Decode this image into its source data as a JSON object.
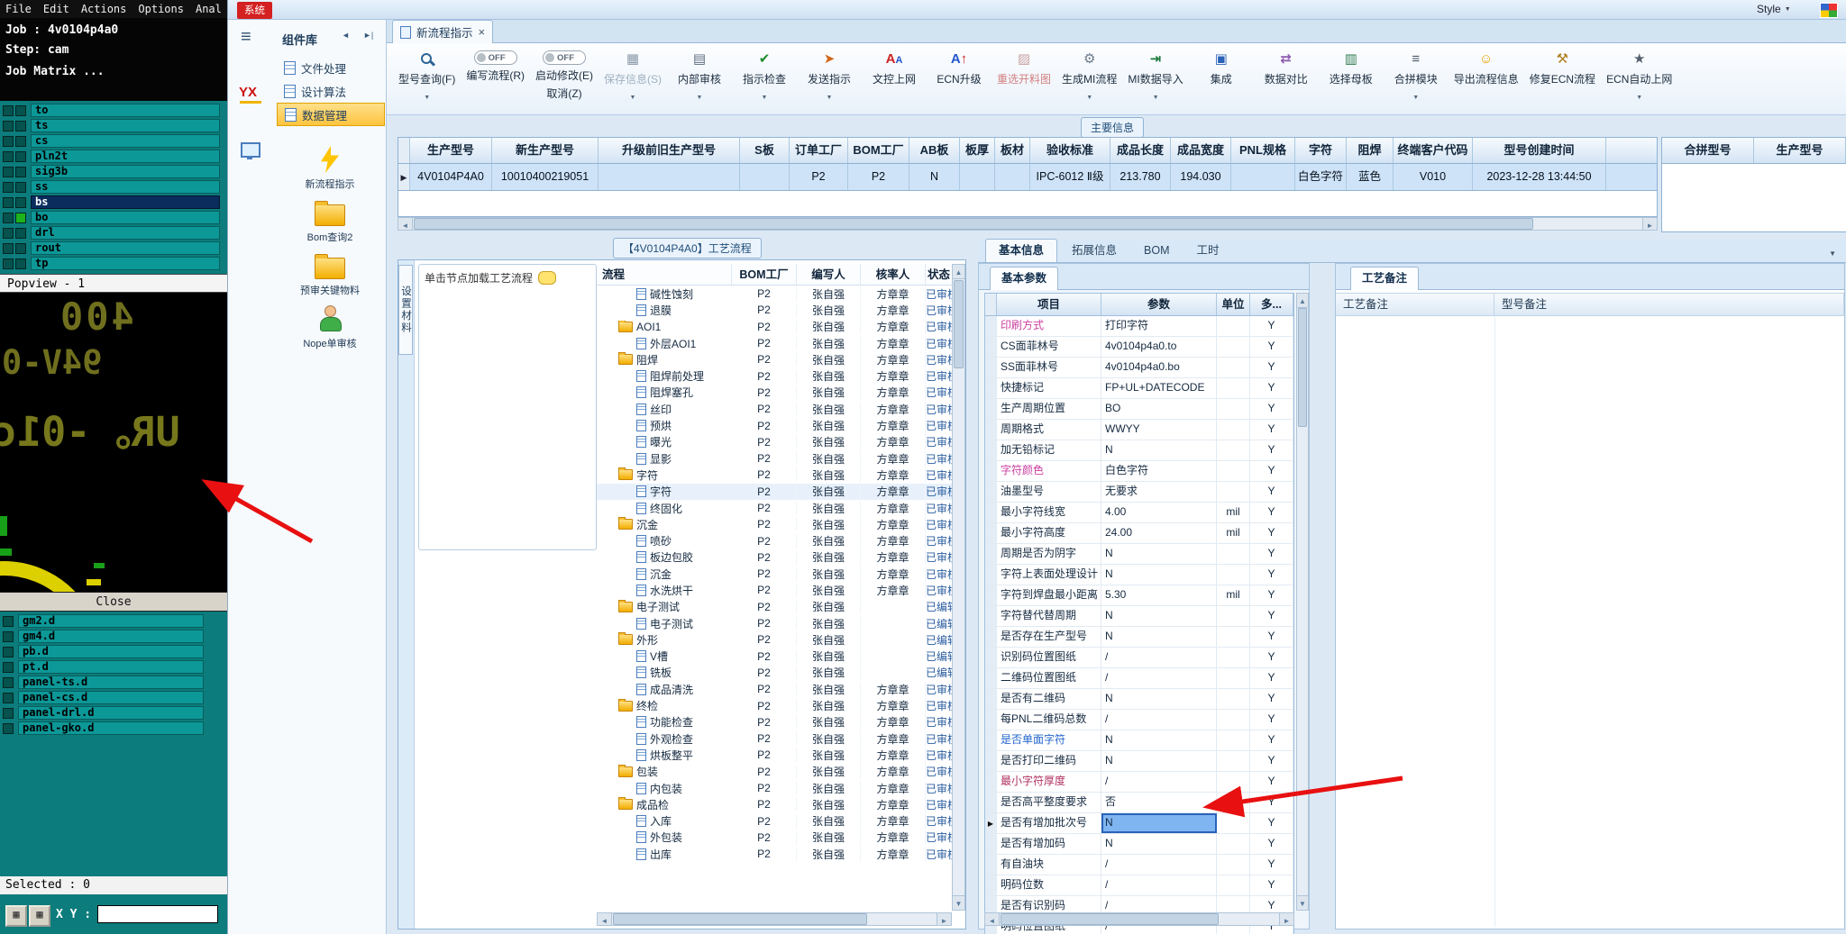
{
  "cam": {
    "menu": [
      "File",
      "Edit",
      "Actions",
      "Options",
      "Anal"
    ],
    "job_line": "Job : 4v0104p4a0",
    "step_line": "Step: cam",
    "matrix_button": "Job Matrix ...",
    "layers": [
      {
        "name": "to"
      },
      {
        "name": "ts"
      },
      {
        "name": "cs"
      },
      {
        "name": "pln2t"
      },
      {
        "name": "sig3b"
      },
      {
        "name": "ss"
      },
      {
        "name": "bs",
        "cls": "selected"
      },
      {
        "name": "bo",
        "cls": "marked"
      },
      {
        "name": "drl"
      },
      {
        "name": "rout"
      },
      {
        "name": "tp"
      }
    ],
    "popview_label": "Popview - 1",
    "viewport": {
      "text1": "400",
      "text2": "94V-0",
      "text3": "UR。-01c"
    },
    "close_label": "Close",
    "files": [
      {
        "name": "gm2.d"
      },
      {
        "name": "gm4.d"
      },
      {
        "name": "pb.d"
      },
      {
        "name": "pt.d"
      },
      {
        "name": "panel-ts.d"
      },
      {
        "name": "panel-cs.d"
      },
      {
        "name": "panel-drl.d"
      },
      {
        "name": "panel-gko.d"
      }
    ],
    "selected_label": "Selected : 0",
    "xy_label": "X Y :"
  },
  "system": {
    "window_tag": "系统",
    "style_label": "Style",
    "component_panel": {
      "title": "组件库",
      "logo": "YX",
      "sidebar": [
        {
          "label": "文件处理"
        },
        {
          "label": "设计算法"
        },
        {
          "label": "数据管理",
          "cls": "active"
        }
      ],
      "shortcuts": [
        {
          "label": "新流程指示",
          "icon": "lightning"
        },
        {
          "label": "Bom查询2",
          "icon": "folder"
        },
        {
          "label": "预审关键物料",
          "icon": "folder"
        },
        {
          "label": "Nope单审核",
          "icon": "person"
        }
      ]
    },
    "tab": {
      "label": "新流程指示"
    },
    "toolbar": [
      {
        "label": "型号查询(F)",
        "icon": "search",
        "dropdown": true
      },
      {
        "label": "编写流程(R)",
        "toggle": "OFF"
      },
      {
        "label": "启动修改(E)",
        "label2": "取消(Z)",
        "toggle": "OFF"
      },
      {
        "label": "保存信息(S)",
        "icon": "save",
        "cls": "disabled",
        "dropdown": true
      },
      {
        "label": "内部审核",
        "icon": "audit",
        "dropdown": true
      },
      {
        "label": "指示检查",
        "icon": "check",
        "dropdown": true
      },
      {
        "label": "发送指示",
        "icon": "send",
        "dropdown": true
      },
      {
        "label": "文控上网",
        "icon": "docnet"
      },
      {
        "label": "ECN升级",
        "icon": "ecnup"
      },
      {
        "label": "重选开料图",
        "icon": "repic",
        "cls": "red"
      },
      {
        "label": "生成MI流程",
        "icon": "gear",
        "dropdown": true
      },
      {
        "label": "MI数据导入",
        "icon": "import",
        "dropdown": true
      },
      {
        "label": "集成",
        "icon": "integrate"
      },
      {
        "label": "数据对比",
        "icon": "compare"
      },
      {
        "label": "选择母板",
        "icon": "board"
      },
      {
        "label": "合拼模块",
        "icon": "merge",
        "dropdown": true
      },
      {
        "label": "导出流程信息",
        "icon": "export"
      },
      {
        "label": "修复ECN流程",
        "icon": "fix"
      },
      {
        "label": "ECN自动上网",
        "icon": "star",
        "dropdown": true
      }
    ]
  },
  "main_info": {
    "tag": "主要信息",
    "columns": [
      "生产型号",
      "新生产型号",
      "升级前旧生产型号",
      "S板",
      "订单工厂",
      "BOM工厂",
      "AB板",
      "板厚",
      "板材",
      "验收标准",
      "成品长度",
      "成品宽度",
      "PNL规格",
      "字符",
      "阻焊",
      "终端客户代码",
      "型号创建时间"
    ],
    "row": [
      "4V0104P4A0",
      "10010400219051",
      "",
      "",
      "P2",
      "P2",
      "N",
      "",
      "",
      "IPC-6012 Ⅱ级",
      "213.780",
      "194.030",
      "",
      "白色字符",
      "蓝色",
      "V010",
      "2023-12-28 13:44:50"
    ],
    "extra_columns": [
      "合拼型号",
      "生产型号"
    ]
  },
  "process": {
    "tag": "【4V0104P4A0】工艺流程",
    "side_tab": "设置材料",
    "hint": "单击节点加载工艺流程",
    "columns": [
      "流程",
      "BOM工厂",
      "编写人",
      "核率人",
      "状态"
    ],
    "rows": [
      {
        "name": "碱性蚀刻",
        "icon": "doc",
        "cls": "lvl2",
        "factory": "P2",
        "writer": "张自强",
        "checker": "方章章",
        "status": "已审核"
      },
      {
        "name": "退膜",
        "icon": "doc",
        "cls": "lvl2",
        "factory": "P2",
        "writer": "张自强",
        "checker": "方章章",
        "status": "已审核"
      },
      {
        "name": "AOI1",
        "icon": "folder",
        "cls": "lvl1",
        "factory": "P2",
        "writer": "张自强",
        "checker": "方章章",
        "status": "已审核"
      },
      {
        "name": "外层AOI1",
        "icon": "doc",
        "cls": "lvl2",
        "factory": "P2",
        "writer": "张自强",
        "checker": "方章章",
        "status": "已审核"
      },
      {
        "name": "阻焊",
        "icon": "folder",
        "cls": "lvl1",
        "factory": "P2",
        "writer": "张自强",
        "checker": "方章章",
        "status": "已审核"
      },
      {
        "name": "阻焊前处理",
        "icon": "doc",
        "cls": "lvl2",
        "factory": "P2",
        "writer": "张自强",
        "checker": "方章章",
        "status": "已审核"
      },
      {
        "name": "阻焊塞孔",
        "icon": "doc",
        "cls": "lvl2",
        "factory": "P2",
        "writer": "张自强",
        "checker": "方章章",
        "status": "已审核"
      },
      {
        "name": "丝印",
        "icon": "doc",
        "cls": "lvl2",
        "factory": "P2",
        "writer": "张自强",
        "checker": "方章章",
        "status": "已审核"
      },
      {
        "name": "预烘",
        "icon": "doc",
        "cls": "lvl2",
        "factory": "P2",
        "writer": "张自强",
        "checker": "方章章",
        "status": "已审核"
      },
      {
        "name": "曝光",
        "icon": "doc",
        "cls": "lvl2",
        "factory": "P2",
        "writer": "张自强",
        "checker": "方章章",
        "status": "已审核"
      },
      {
        "name": "显影",
        "icon": "doc",
        "cls": "lvl2",
        "factory": "P2",
        "writer": "张自强",
        "checker": "方章章",
        "status": "已审核"
      },
      {
        "name": "字符",
        "icon": "folder",
        "cls": "lvl1",
        "factory": "P2",
        "writer": "张自强",
        "checker": "方章章",
        "status": "已审核"
      },
      {
        "name": "字符",
        "icon": "doc",
        "cls": "lvl2 hl",
        "factory": "P2",
        "writer": "张自强",
        "checker": "方章章",
        "status": "已审核"
      },
      {
        "name": "终固化",
        "icon": "doc",
        "cls": "lvl2",
        "factory": "P2",
        "writer": "张自强",
        "checker": "方章章",
        "status": "已审核"
      },
      {
        "name": "沉金",
        "icon": "folder",
        "cls": "lvl1",
        "factory": "P2",
        "writer": "张自强",
        "checker": "方章章",
        "status": "已审核"
      },
      {
        "name": "喷砂",
        "icon": "doc",
        "cls": "lvl2",
        "factory": "P2",
        "writer": "张自强",
        "checker": "方章章",
        "status": "已审核"
      },
      {
        "name": "板边包胶",
        "icon": "doc",
        "cls": "lvl2",
        "factory": "P2",
        "writer": "张自强",
        "checker": "方章章",
        "status": "已审核"
      },
      {
        "name": "沉金",
        "icon": "doc",
        "cls": "lvl2",
        "factory": "P2",
        "writer": "张自强",
        "checker": "方章章",
        "status": "已审核"
      },
      {
        "name": "水洗烘干",
        "icon": "doc",
        "cls": "lvl2",
        "factory": "P2",
        "writer": "张自强",
        "checker": "方章章",
        "status": "已审核"
      },
      {
        "name": "电子测试",
        "icon": "folder",
        "cls": "lvl1",
        "factory": "P2",
        "writer": "张自强",
        "checker": "",
        "status": "已编辑"
      },
      {
        "name": "电子测试",
        "icon": "doc",
        "cls": "lvl2",
        "factory": "P2",
        "writer": "张自强",
        "checker": "",
        "status": "已编辑"
      },
      {
        "name": "外形",
        "icon": "folder",
        "cls": "lvl1",
        "factory": "P2",
        "writer": "张自强",
        "checker": "",
        "status": "已编辑"
      },
      {
        "name": "V槽",
        "icon": "doc",
        "cls": "lvl2",
        "factory": "P2",
        "writer": "张自强",
        "checker": "",
        "status": "已编辑"
      },
      {
        "name": "铣板",
        "icon": "doc",
        "cls": "lvl2",
        "factory": "P2",
        "writer": "张自强",
        "checker": "",
        "status": "已编辑"
      },
      {
        "name": "成品清洗",
        "icon": "doc",
        "cls": "lvl2",
        "factory": "P2",
        "writer": "张自强",
        "checker": "方章章",
        "status": "已审核"
      },
      {
        "name": "终检",
        "icon": "folder",
        "cls": "lvl1",
        "factory": "P2",
        "writer": "张自强",
        "checker": "方章章",
        "status": "已审核"
      },
      {
        "name": "功能检查",
        "icon": "doc",
        "cls": "lvl2",
        "factory": "P2",
        "writer": "张自强",
        "checker": "方章章",
        "status": "已审核"
      },
      {
        "name": "外观检查",
        "icon": "doc",
        "cls": "lvl2",
        "factory": "P2",
        "writer": "张自强",
        "checker": "方章章",
        "status": "已审核"
      },
      {
        "name": "烘板整平",
        "icon": "doc",
        "cls": "lvl2",
        "factory": "P2",
        "writer": "张自强",
        "checker": "方章章",
        "status": "已审核"
      },
      {
        "name": "包装",
        "icon": "folder",
        "cls": "lvl1",
        "factory": "P2",
        "writer": "张自强",
        "checker": "方章章",
        "status": "已审核"
      },
      {
        "name": "内包装",
        "icon": "doc",
        "cls": "lvl2",
        "factory": "P2",
        "writer": "张自强",
        "checker": "方章章",
        "status": "已审核"
      },
      {
        "name": "成品检",
        "icon": "folder",
        "cls": "lvl1",
        "factory": "P2",
        "writer": "张自强",
        "checker": "方章章",
        "status": "已审核"
      },
      {
        "name": "入库",
        "icon": "doc",
        "cls": "lvl2",
        "factory": "P2",
        "writer": "张自强",
        "checker": "方章章",
        "status": "已审核"
      },
      {
        "name": "外包装",
        "icon": "doc",
        "cls": "lvl2",
        "factory": "P2",
        "writer": "张自强",
        "checker": "方章章",
        "status": "已审核"
      },
      {
        "name": "出库",
        "icon": "doc",
        "cls": "lvl2",
        "factory": "P2",
        "writer": "张自强",
        "checker": "方章章",
        "status": "已审核"
      }
    ]
  },
  "params": {
    "tabs": [
      {
        "label": "基本信息",
        "cls": "active"
      },
      {
        "label": "拓展信息"
      },
      {
        "label": "BOM"
      },
      {
        "label": "工时"
      }
    ],
    "sub_tab": "基本参数",
    "columns": [
      "项目",
      "参数",
      "单位",
      "多..."
    ],
    "rows": [
      {
        "item": "印刷方式",
        "value": "打印字符",
        "unit": "",
        "multi": "Y",
        "item_cls": "magenta"
      },
      {
        "item": "CS面菲林号",
        "value": "4v0104p4a0.to",
        "unit": "",
        "multi": "Y"
      },
      {
        "item": "SS面菲林号",
        "value": "4v0104p4a0.bo",
        "unit": "",
        "multi": "Y"
      },
      {
        "item": "快捷标记",
        "value": "FP+UL+DATECODE",
        "unit": "",
        "multi": "Y"
      },
      {
        "item": "生产周期位置",
        "value": "BO",
        "unit": "",
        "multi": "Y"
      },
      {
        "item": "周期格式",
        "value": "WWYY",
        "unit": "",
        "multi": "Y"
      },
      {
        "item": "加无铅标记",
        "value": "N",
        "unit": "",
        "multi": "Y"
      },
      {
        "item": "字符颜色",
        "value": "白色字符",
        "unit": "",
        "multi": "Y",
        "item_cls": "magenta"
      },
      {
        "item": "油墨型号",
        "value": "无要求",
        "unit": "",
        "multi": "Y"
      },
      {
        "item": "最小字符线宽",
        "value": "4.00",
        "unit": "mil",
        "multi": "Y"
      },
      {
        "item": "最小字符高度",
        "value": "24.00",
        "unit": "mil",
        "multi": "Y"
      },
      {
        "item": "周期是否为阴字",
        "value": "N",
        "unit": "",
        "multi": "Y"
      },
      {
        "item": "字符上表面处理设计",
        "value": "N",
        "unit": "",
        "multi": "Y"
      },
      {
        "item": "字符到焊盘最小距离",
        "value": "5.30",
        "unit": "mil",
        "multi": "Y"
      },
      {
        "item": "字符替代替周期",
        "value": "N",
        "unit": "",
        "multi": "Y"
      },
      {
        "item": "是否存在生产型号",
        "value": "N",
        "unit": "",
        "multi": "Y"
      },
      {
        "item": "识别码位置图纸",
        "value": "/",
        "unit": "",
        "multi": "Y"
      },
      {
        "item": "二维码位置图纸",
        "value": "/",
        "unit": "",
        "multi": "Y"
      },
      {
        "item": "是否有二维码",
        "value": "N",
        "unit": "",
        "multi": "Y"
      },
      {
        "item": "每PNL二维码总数",
        "value": "/",
        "unit": "",
        "multi": "Y"
      },
      {
        "item": "是否单面字符",
        "value": "N",
        "unit": "",
        "multi": "Y",
        "item_cls": "blue"
      },
      {
        "item": "是否打印二维码",
        "value": "N",
        "unit": "",
        "multi": "Y"
      },
      {
        "item": "最小字符厚度",
        "value": "/",
        "unit": "",
        "multi": "Y",
        "item_cls": "maroon"
      },
      {
        "item": "是否高平整度要求",
        "value": "否",
        "unit": "",
        "multi": "Y"
      },
      {
        "item": "是否有增加批次号",
        "value": "N",
        "unit": "",
        "multi": "Y",
        "value_cls": "selected",
        "marker": true
      },
      {
        "item": "是否有增加码",
        "value": "N",
        "unit": "",
        "multi": "Y"
      },
      {
        "item": "有自油块",
        "value": "/",
        "unit": "",
        "multi": "Y"
      },
      {
        "item": "明码位数",
        "value": "/",
        "unit": "",
        "multi": "Y"
      },
      {
        "item": "是否有识别码",
        "value": "/",
        "unit": "",
        "multi": "Y"
      },
      {
        "item": "明码位置图纸",
        "value": "/",
        "unit": "",
        "multi": "Y"
      }
    ]
  },
  "remarks": {
    "sub_tab": "工艺备注",
    "columns": [
      "工艺备注",
      "型号备注"
    ]
  }
}
